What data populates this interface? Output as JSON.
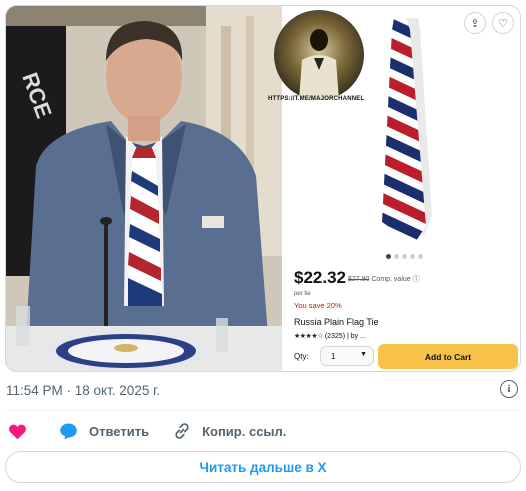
{
  "product": {
    "price": "$22.32",
    "was_price": "$27.90",
    "comp_label": "Comp. value",
    "per_unit": "per tie",
    "savings": "You save 20%",
    "title": "Russia Plain Flag Tie",
    "rating_stars": "★★★★☆",
    "rating_count": "(2325) | by ...",
    "qty_label": "Qty:",
    "qty_value": "1",
    "add_to_cart": "Add to Cart",
    "watermark": "HTTPS://T.ME/MAJORCHANNEL"
  },
  "tweet": {
    "timestamp": "11:54 PM · 18 окт. 2025 г.",
    "reply_label": "Ответить",
    "copy_link_label": "Копир. ссыл.",
    "read_more_label": "Читать дальше в X"
  },
  "colors": {
    "like": "#f91880",
    "reply": "#1d9bf0",
    "link_text": "#1d9bf0",
    "muted": "#536471",
    "cart_button": "#f7c14a"
  }
}
